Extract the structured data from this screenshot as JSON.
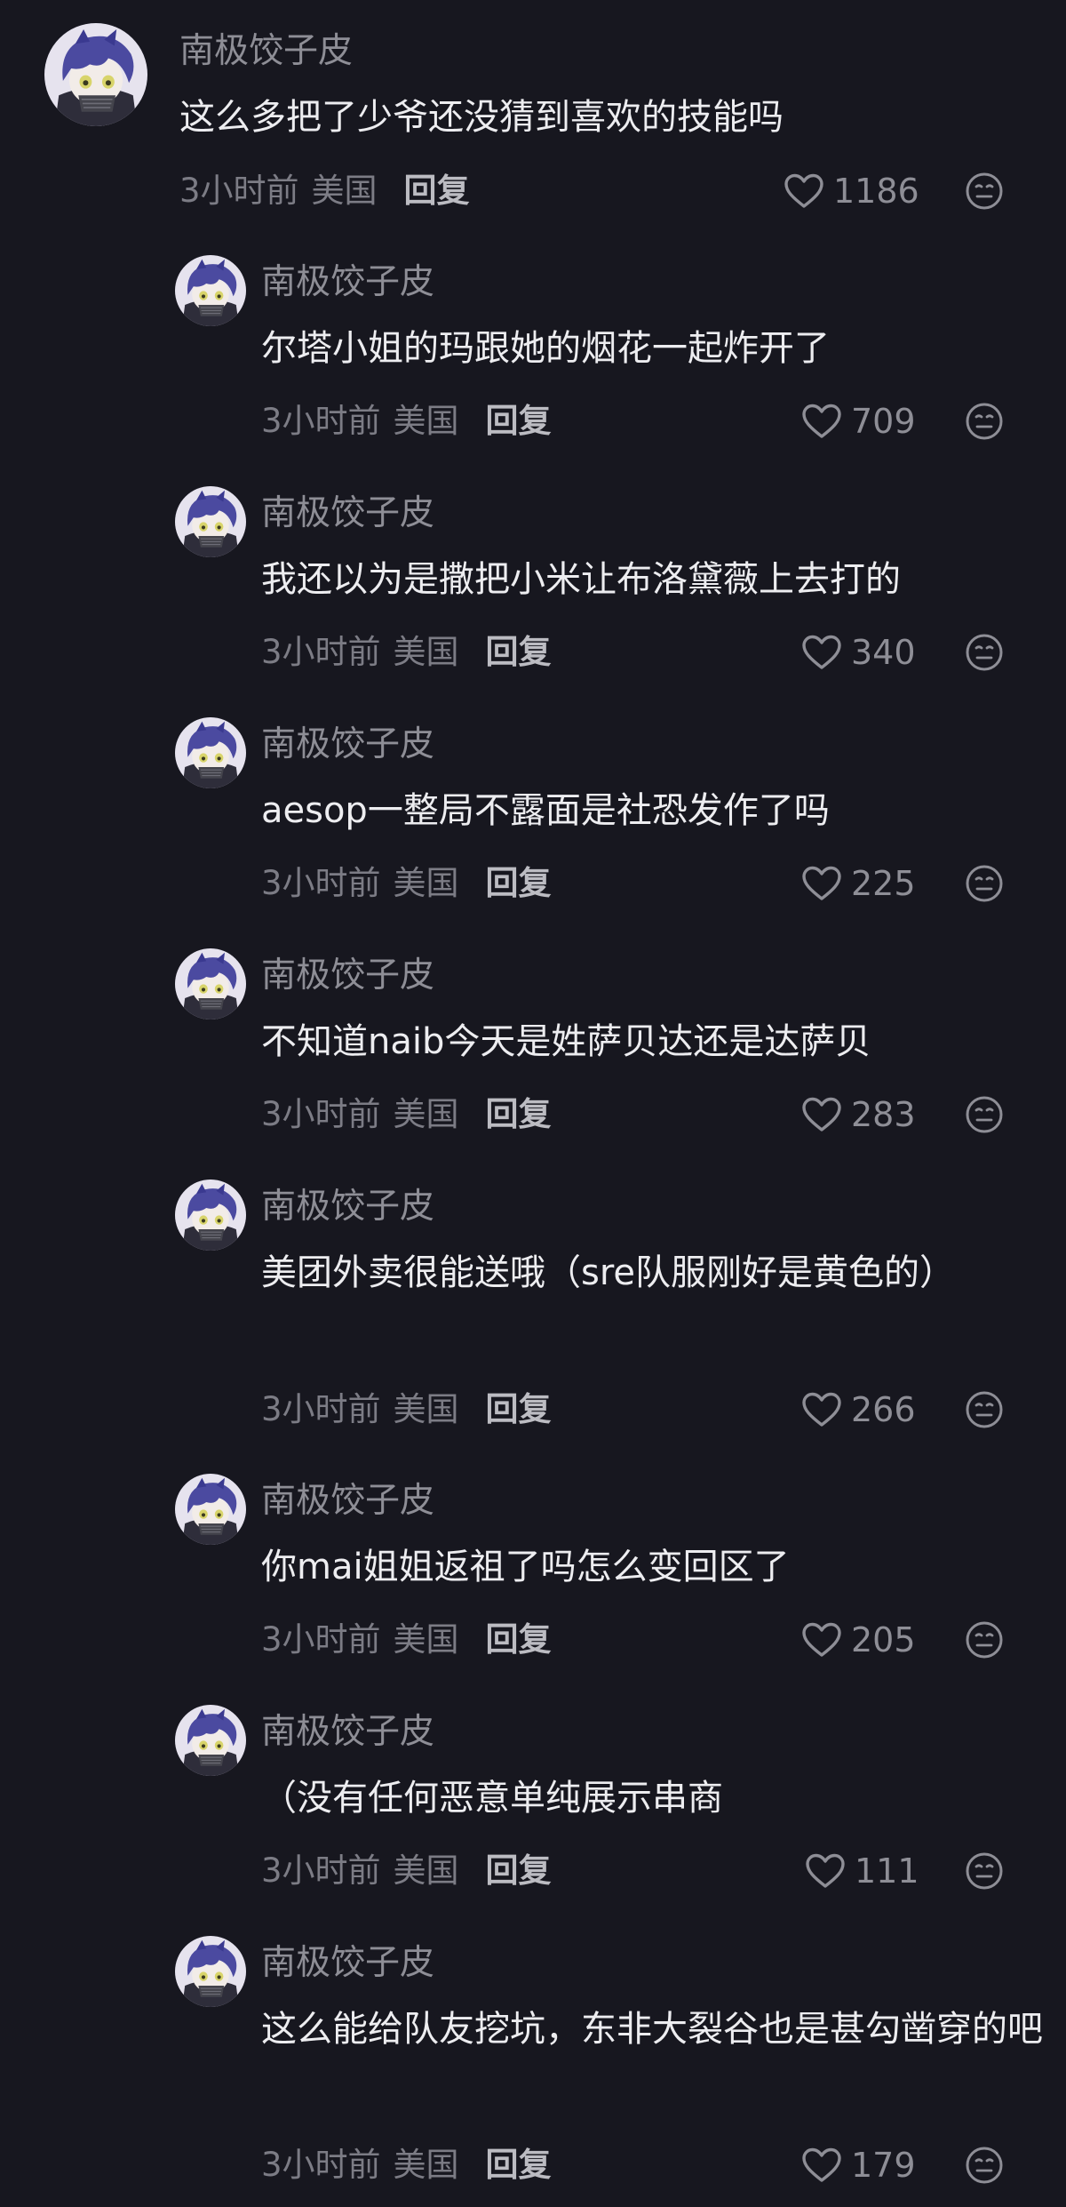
{
  "comments": [
    {
      "username": "南极饺子皮",
      "text": "这么多把了少爷还没猜到喜欢的技能吗",
      "time": "3小时前",
      "location": "美国",
      "reply_label": "回复",
      "likes": "1186"
    },
    {
      "username": "南极饺子皮",
      "text": "尔塔小姐的玛跟她的烟花一起炸开了",
      "time": "3小时前",
      "location": "美国",
      "reply_label": "回复",
      "likes": "709"
    },
    {
      "username": "南极饺子皮",
      "text": "我还以为是撒把小米让布洛黛薇上去打的",
      "time": "3小时前",
      "location": "美国",
      "reply_label": "回复",
      "likes": "340"
    },
    {
      "username": "南极饺子皮",
      "text": "aesop一整局不露面是社恐发作了吗",
      "time": "3小时前",
      "location": "美国",
      "reply_label": "回复",
      "likes": "225"
    },
    {
      "username": "南极饺子皮",
      "text": "不知道naib今天是姓萨贝达还是达萨贝",
      "time": "3小时前",
      "location": "美国",
      "reply_label": "回复",
      "likes": "283"
    },
    {
      "username": "南极饺子皮",
      "text": "美团外卖很能送哦（sre队服刚好是黄色的）",
      "time": "3小时前",
      "location": "美国",
      "reply_label": "回复",
      "likes": "266"
    },
    {
      "username": "南极饺子皮",
      "text": "你mai姐姐返祖了吗怎么变回区了",
      "time": "3小时前",
      "location": "美国",
      "reply_label": "回复",
      "likes": "205"
    },
    {
      "username": "南极饺子皮",
      "text": "（没有任何恶意单纯展示串商",
      "time": "3小时前",
      "location": "美国",
      "reply_label": "回复",
      "likes": "111"
    },
    {
      "username": "南极饺子皮",
      "text": "这么能给队友挖坑，东非大裂谷也是甚勾凿穿的吧",
      "time": "3小时前",
      "location": "美国",
      "reply_label": "回复",
      "likes": "179"
    }
  ],
  "colors": {
    "background": "#17171f",
    "username": "#8e8e96",
    "text": "#ededf0",
    "meta": "#7c7c85",
    "reply": "#bcbcc2"
  },
  "icons": {
    "like": "heart-outline-icon",
    "more": "emoji-face-icon"
  }
}
